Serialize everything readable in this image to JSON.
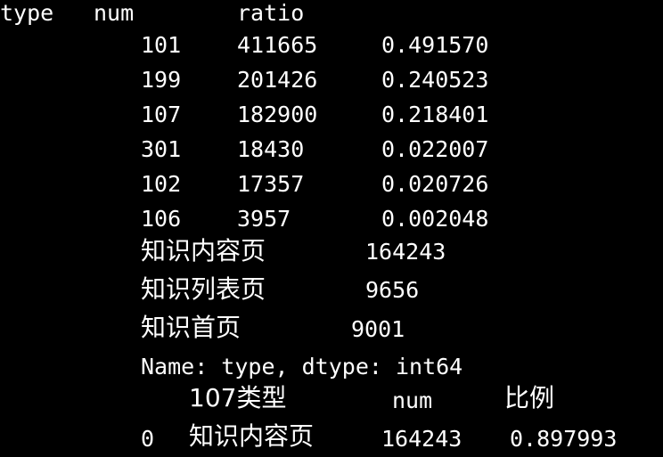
{
  "header": {
    "col_type": "type",
    "col_num": "num",
    "col_ratio": "ratio"
  },
  "type_counts": [
    {
      "type": "101",
      "num": "411665",
      "ratio": "0.491570"
    },
    {
      "type": "199",
      "num": "201426",
      "ratio": "0.240523"
    },
    {
      "type": "107",
      "num": "182900",
      "ratio": "0.218401"
    },
    {
      "type": "301",
      "num": "18430",
      "ratio": "0.022007"
    },
    {
      "type": "102",
      "num": "17357",
      "ratio": "0.020726"
    },
    {
      "type": "106",
      "num": "3957",
      "ratio": "0.002048"
    }
  ],
  "series_107": [
    {
      "label": "知识内容页",
      "value": "164243"
    },
    {
      "label": "知识列表页",
      "value": "9656"
    },
    {
      "label": "知识首页",
      "value": "9001"
    }
  ],
  "series_footer": "Name: type, dtype: int64",
  "df_header": {
    "col_type": "107类型",
    "col_num": "num",
    "col_ratio": "比例"
  },
  "df_rows": [
    {
      "index": "0",
      "type": "知识内容页",
      "num": "164243",
      "ratio": "0.897993"
    }
  ]
}
